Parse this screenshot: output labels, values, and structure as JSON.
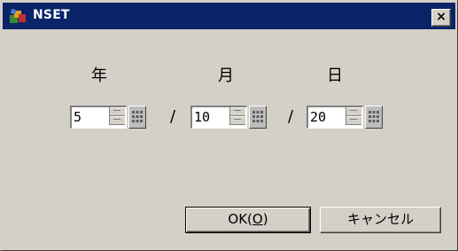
{
  "window": {
    "title": "NSET",
    "close_glyph": "×",
    "title_bar_color": "#0a246a",
    "face_color": "#d4d0c8",
    "app_icon": "app-icon"
  },
  "labels": {
    "year": "年",
    "month": "月",
    "day": "日"
  },
  "fields": {
    "year": {
      "value": "5"
    },
    "month": {
      "value": "10"
    },
    "day": {
      "value": "20"
    }
  },
  "separator": "/",
  "buttons": {
    "ok_prefix": "OK(",
    "ok_mnemonic": "O",
    "ok_suffix": ")",
    "cancel": "キャンセル"
  }
}
